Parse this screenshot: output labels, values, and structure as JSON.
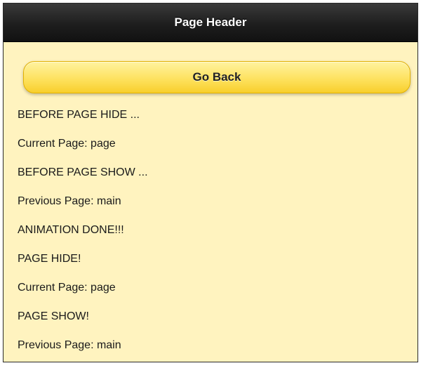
{
  "header": {
    "title": "Page Header"
  },
  "back_button": {
    "label": "Go Back"
  },
  "log": [
    "BEFORE PAGE HIDE ...",
    "Current Page: page",
    "BEFORE PAGE SHOW ...",
    "Previous Page: main",
    "ANIMATION DONE!!!",
    "PAGE HIDE!",
    "Current Page: page",
    "PAGE SHOW!",
    "Previous Page: main"
  ],
  "colors": {
    "page_background": "#fff3bf",
    "header_background": "#1e1e1e",
    "button_background": "#fde05a"
  }
}
